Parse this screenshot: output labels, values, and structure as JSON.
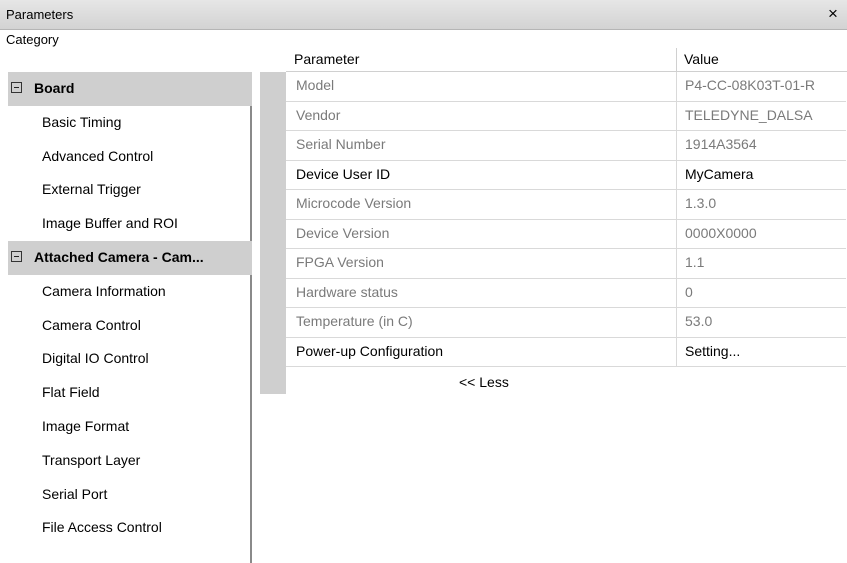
{
  "window": {
    "title": "Parameters",
    "close_glyph": "×"
  },
  "category_header": "Category",
  "columns": {
    "parameter": "Parameter",
    "value": "Value"
  },
  "categories": [
    {
      "label": "Board",
      "group": true
    },
    {
      "label": "Basic Timing",
      "group": false
    },
    {
      "label": "Advanced Control",
      "group": false
    },
    {
      "label": "External Trigger",
      "group": false
    },
    {
      "label": "Image Buffer and ROI",
      "group": false
    },
    {
      "label": "Attached Camera - Cam...",
      "group": true
    },
    {
      "label": "Camera Information",
      "group": false
    },
    {
      "label": "Camera Control",
      "group": false
    },
    {
      "label": "Digital IO Control",
      "group": false
    },
    {
      "label": "Flat Field",
      "group": false
    },
    {
      "label": "Image Format",
      "group": false
    },
    {
      "label": "Transport Layer",
      "group": false
    },
    {
      "label": "Serial Port",
      "group": false
    },
    {
      "label": "File Access Control",
      "group": false
    }
  ],
  "parameters": [
    {
      "name": "Model",
      "value": "P4-CC-08K03T-01-R",
      "readonly": true
    },
    {
      "name": "Vendor",
      "value": "TELEDYNE_DALSA",
      "readonly": true
    },
    {
      "name": "Serial Number",
      "value": "1914A3564",
      "readonly": true
    },
    {
      "name": "Device User ID",
      "value": "MyCamera",
      "readonly": false
    },
    {
      "name": "Microcode Version",
      "value": "1.3.0",
      "readonly": true
    },
    {
      "name": "Device Version",
      "value": "0000X0000",
      "readonly": true
    },
    {
      "name": "FPGA Version",
      "value": "1.1",
      "readonly": true
    },
    {
      "name": "Hardware status",
      "value": "0",
      "readonly": true
    },
    {
      "name": "Temperature (in C)",
      "value": "53.0",
      "readonly": true
    },
    {
      "name": "Power-up Configuration",
      "value": "Setting...",
      "readonly": false
    }
  ],
  "less_link": "<< Less"
}
